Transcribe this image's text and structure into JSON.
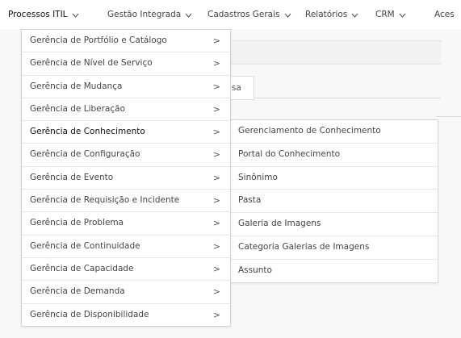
{
  "topnav": {
    "items": [
      {
        "label": "Processos ITIL"
      },
      {
        "label": "Gestão Integrada"
      },
      {
        "label": "Cadastros Gerais"
      },
      {
        "label": "Relatórios"
      },
      {
        "label": "CRM"
      },
      {
        "label": "Aces"
      }
    ]
  },
  "background": {
    "tab_label_fragment": "isa"
  },
  "menu": {
    "items": [
      {
        "label": "Gerência de Portfólio e Catálogo"
      },
      {
        "label": "Gerência de Nível de Serviço"
      },
      {
        "label": "Gerência de Mudança"
      },
      {
        "label": "Gerência de Liberação"
      },
      {
        "label": "Gerência de Conhecimento"
      },
      {
        "label": "Gerência de Configuração"
      },
      {
        "label": "Gerência de Evento"
      },
      {
        "label": "Gerência de Requisição e Incidente"
      },
      {
        "label": "Gerência de Problema"
      },
      {
        "label": "Gerência de Continuidade"
      },
      {
        "label": "Gerência de Capacidade"
      },
      {
        "label": "Gerência de Demanda"
      },
      {
        "label": "Gerência de Disponibilidade"
      }
    ],
    "active_item": "Gerência de Conhecimento"
  },
  "submenu": {
    "items": [
      {
        "label": "Gerenciamento de Conhecimento"
      },
      {
        "label": "Portal do Conhecimento"
      },
      {
        "label": "Sinônimo"
      },
      {
        "label": "Pasta"
      },
      {
        "label": "Galeria de Imagens"
      },
      {
        "label": "Categoria Galerias de Imagens"
      },
      {
        "label": "Assunto"
      }
    ]
  },
  "icons": {
    "nav_dropdown": "chevron-down-icon",
    "menu_arrow": "chevron-right-icon"
  }
}
